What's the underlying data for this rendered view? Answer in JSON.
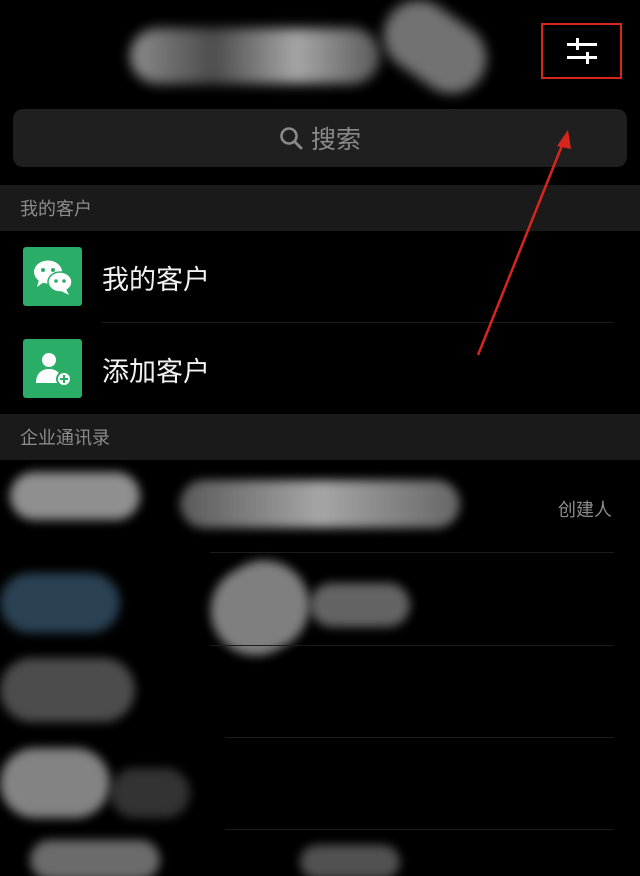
{
  "header": {
    "filter_button": {
      "icon": "sliders-icon",
      "highlight_color": "#d9261c"
    }
  },
  "search": {
    "icon": "search-icon",
    "label": "搜索"
  },
  "sections": {
    "customers": {
      "header": "我的客户",
      "items": [
        {
          "label": "我的客户",
          "icon": "wechat-icon"
        },
        {
          "label": "添加客户",
          "icon": "add-contact-icon"
        }
      ]
    },
    "directory": {
      "header": "企业通讯录",
      "creator_badge": "创建人"
    }
  },
  "colors": {
    "accent_green": "#2aae67",
    "annotation_red": "#d9261c",
    "background": "#000000"
  }
}
